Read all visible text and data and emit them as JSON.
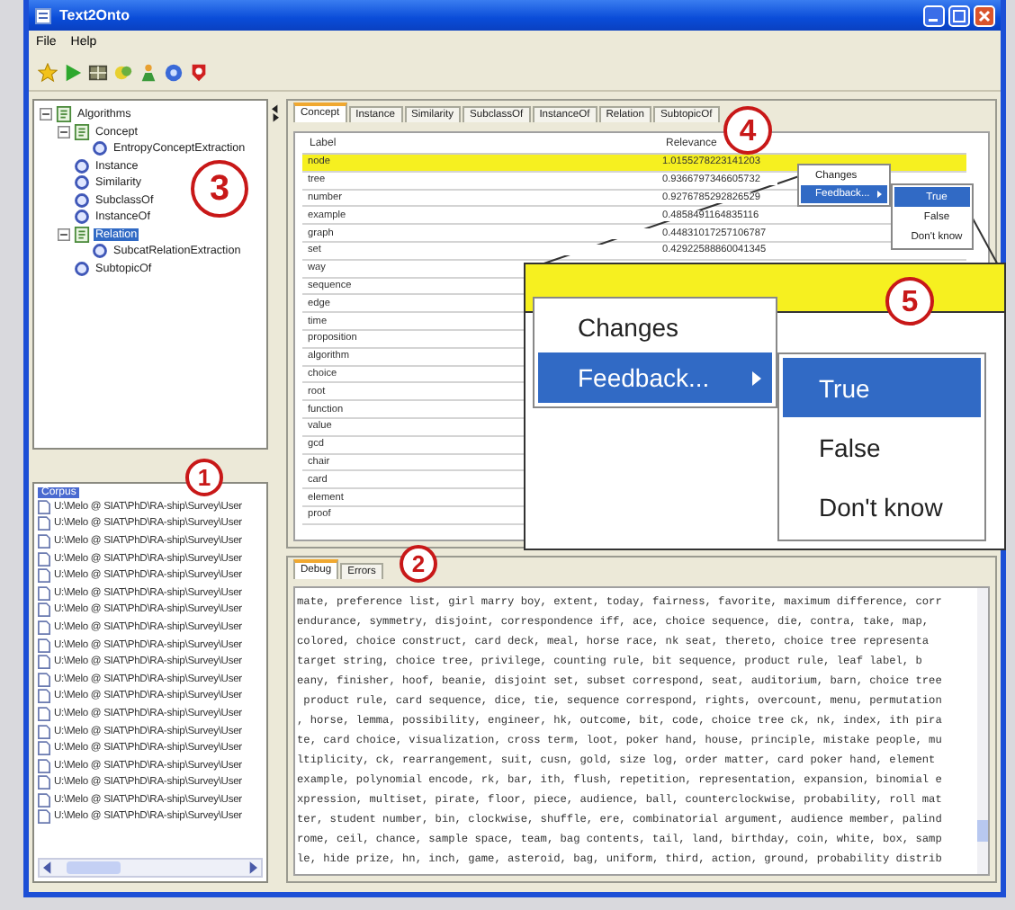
{
  "window": {
    "title": "Text2Onto"
  },
  "menu": [
    "File",
    "Help"
  ],
  "algorithm_tree": [
    {
      "label": "Algorithms",
      "kind": "folder",
      "expanded": true,
      "selected": false,
      "children": [
        {
          "label": "Concept",
          "kind": "folder",
          "expanded": true,
          "selected": false,
          "children": [
            {
              "label": "EntropyConceptExtraction",
              "kind": "algorithm",
              "selected": false
            }
          ]
        },
        {
          "label": "Instance",
          "kind": "algorithm",
          "selected": false
        },
        {
          "label": "Similarity",
          "kind": "algorithm",
          "selected": false
        },
        {
          "label": "SubclassOf",
          "kind": "algorithm",
          "selected": false
        },
        {
          "label": "InstanceOf",
          "kind": "algorithm",
          "selected": false
        },
        {
          "label": "Relation",
          "kind": "folder",
          "expanded": true,
          "selected": true,
          "children": [
            {
              "label": "SubcatRelationExtraction",
              "kind": "algorithm",
              "selected": false
            }
          ]
        },
        {
          "label": "SubtopicOf",
          "kind": "algorithm",
          "selected": false
        }
      ]
    }
  ],
  "corpus": {
    "header": "Corpus",
    "documents": [
      "U:\\Melo @ SIAT\\PhD\\RA-ship\\Survey\\User",
      "U:\\Melo @ SIAT\\PhD\\RA-ship\\Survey\\User",
      "U:\\Melo @ SIAT\\PhD\\RA-ship\\Survey\\User",
      "U:\\Melo @ SIAT\\PhD\\RA-ship\\Survey\\User",
      "U:\\Melo @ SIAT\\PhD\\RA-ship\\Survey\\User",
      "U:\\Melo @ SIAT\\PhD\\RA-ship\\Survey\\User",
      "U:\\Melo @ SIAT\\PhD\\RA-ship\\Survey\\User",
      "U:\\Melo @ SIAT\\PhD\\RA-ship\\Survey\\User",
      "U:\\Melo @ SIAT\\PhD\\RA-ship\\Survey\\User",
      "U:\\Melo @ SIAT\\PhD\\RA-ship\\Survey\\User",
      "U:\\Melo @ SIAT\\PhD\\RA-ship\\Survey\\User",
      "U:\\Melo @ SIAT\\PhD\\RA-ship\\Survey\\User",
      "U:\\Melo @ SIAT\\PhD\\RA-ship\\Survey\\User",
      "U:\\Melo @ SIAT\\PhD\\RA-ship\\Survey\\User",
      "U:\\Melo @ SIAT\\PhD\\RA-ship\\Survey\\User",
      "U:\\Melo @ SIAT\\PhD\\RA-ship\\Survey\\User",
      "U:\\Melo @ SIAT\\PhD\\RA-ship\\Survey\\User",
      "U:\\Melo @ SIAT\\PhD\\RA-ship\\Survey\\User",
      "U:\\Melo @ SIAT\\PhD\\RA-ship\\Survey\\User"
    ]
  },
  "result_tabs": [
    {
      "label": "Concept",
      "selected": true
    },
    {
      "label": "Instance",
      "selected": false
    },
    {
      "label": "Similarity",
      "selected": false
    },
    {
      "label": "SubclassOf",
      "selected": false
    },
    {
      "label": "InstanceOf",
      "selected": false
    },
    {
      "label": "Relation",
      "selected": false
    },
    {
      "label": "SubtopicOf",
      "selected": false
    }
  ],
  "table": {
    "columns": [
      "Label",
      "Relevance"
    ],
    "rows": [
      {
        "label": "node",
        "relevance": "1.0155278223141203",
        "selected": true
      },
      {
        "label": "tree",
        "relevance": "0.9366797346605732",
        "selected": false
      },
      {
        "label": "number",
        "relevance": "0.9276785292826529",
        "selected": false
      },
      {
        "label": "example",
        "relevance": "0.4858491164835116",
        "selected": false
      },
      {
        "label": "graph",
        "relevance": "0.44831017257106787",
        "selected": false
      },
      {
        "label": "set",
        "relevance": "0.42922588860041345",
        "selected": false
      },
      {
        "label": "way",
        "selected": false
      },
      {
        "label": "sequence",
        "selected": false
      },
      {
        "label": "edge",
        "selected": false
      },
      {
        "label": "time",
        "selected": false
      },
      {
        "label": "proposition",
        "selected": false
      },
      {
        "label": "algorithm",
        "selected": false
      },
      {
        "label": "choice",
        "selected": false
      },
      {
        "label": "root",
        "selected": false
      },
      {
        "label": "function",
        "selected": false
      },
      {
        "label": "value",
        "selected": false
      },
      {
        "label": "gcd",
        "selected": false
      },
      {
        "label": "chair",
        "selected": false
      },
      {
        "label": "card",
        "selected": false
      },
      {
        "label": "element",
        "selected": false
      },
      {
        "label": "proof",
        "selected": false
      }
    ]
  },
  "context_menu": {
    "items": [
      {
        "label": "Changes",
        "selected": false,
        "has_submenu": false
      },
      {
        "label": "Feedback...",
        "selected": true,
        "has_submenu": true
      }
    ],
    "submenu": [
      {
        "label": "True",
        "selected": true
      },
      {
        "label": "False",
        "selected": false
      },
      {
        "label": "Don't know",
        "selected": false
      }
    ]
  },
  "zoomed_menu": {
    "items": [
      {
        "label": "Changes",
        "selected": false,
        "has_submenu": false
      },
      {
        "label": "Feedback...",
        "selected": true,
        "has_submenu": true
      }
    ],
    "submenu": [
      {
        "label": "True",
        "selected": true
      },
      {
        "label": "False",
        "selected": false
      },
      {
        "label": "Don't know",
        "selected": false
      }
    ]
  },
  "log_tabs": [
    {
      "label": "Debug",
      "selected": true
    },
    {
      "label": "Errors",
      "selected": false
    }
  ],
  "log_lines": [
    "mate, preference list, girl marry boy, extent, today, fairness, favorite, maximum difference, corr",
    "endurance, symmetry, disjoint, correspondence iff, ace, choice sequence, die, contra, take, map,",
    "colored, choice construct, card deck, meal, horse race, nk seat, thereto, choice tree representa",
    "target string, choice tree, privilege, counting rule, bit sequence, product rule, leaf label, b",
    "eany, finisher, hoof, beanie, disjoint set, subset correspond, seat, auditorium, barn, choice tree",
    " product rule, card sequence, dice, tie, sequence correspond, rights, overcount, menu, permutation",
    ", horse, lemma, possibility, engineer, hk, outcome, bit, code, choice tree ck, nk, index, ith pira",
    "te, card choice, visualization, cross term, loot, poker hand, house, principle, mistake people, mu",
    "ltiplicity, ck, rearrangement, suit, cusn, gold, size log, order matter, card poker hand, element",
    "example, polynomial encode, rk, bar, ith, flush, repetition, representation, expansion, binomial e",
    "xpression, multiset, pirate, floor, piece, audience, ball, counterclockwise, probability, roll mat",
    "ter, student number, bin, clockwise, shuffle, ere, combinatorial argument, audience member, palind",
    "rome, ceil, chance, sample space, team, bag contents, tail, land, birthday, coin, white, box, samp",
    "le, hide prize, hn, inch, game, asteroid, bag, uniform, third, action, ground, probability distrib"
  ],
  "callouts": [
    "1",
    "2",
    "3",
    "4",
    "5"
  ]
}
